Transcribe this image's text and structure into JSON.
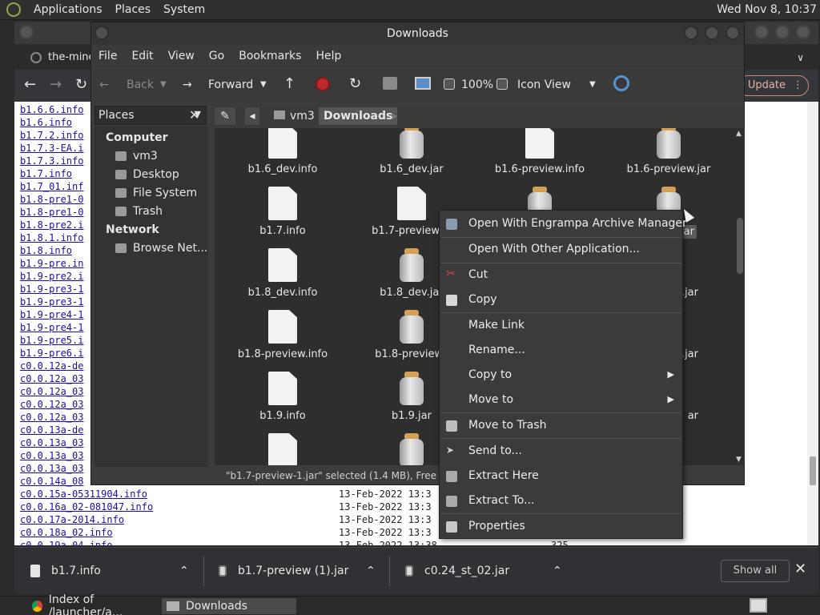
{
  "top_panel": {
    "menus": [
      "Applications",
      "Places",
      "System"
    ],
    "clock": "Wed Nov 8, 10:37"
  },
  "browser": {
    "tab_title": "the-mine",
    "update_label": "Update",
    "listing_rows": [
      "b1.6.6.info",
      "b1.6.info",
      "b1.7.2.info",
      "b1.7.3-EA.i",
      "b1.7.3.info",
      "b1.7.info",
      "b1.7_01.inf",
      "b1.8-pre1-0",
      "b1.8-pre1-0",
      "b1.8-pre2.i",
      "b1.8.1.info",
      "b1.8.info",
      "b1.9-pre.in",
      "b1.9-pre2.i",
      "b1.9-pre3-1",
      "b1.9-pre3-1",
      "b1.9-pre4-1",
      "b1.9-pre4-1",
      "b1.9-pre5.i",
      "b1.9-pre6.i",
      "c0.0.12a-de",
      "c0.0.12a_03",
      "c0.0.12a_03",
      "c0.0.12a_03",
      "c0.0.12a_03",
      "c0.0.13a-de",
      "c0.0.13a_03",
      "c0.0.13a_03",
      "c0.0.13a_03",
      "c0.0.14a_08",
      "c0.0.15a-05311904.info",
      "c0.0.16a_02-081047.info",
      "c0.0.17a-2014.info",
      "c0.0.18a_02.info",
      "c0.0.19a_04.info"
    ],
    "listing_dates": [
      "13-Feb-2022 13:3",
      "13-Feb-2022 13:3",
      "13-Feb-2022 13:3",
      "13-Feb-2022 13:3",
      "13-Feb-2022 13:38"
    ],
    "listing_last_size": "325"
  },
  "downloads_bar": {
    "items": [
      "b1.7.info",
      "b1.7-preview (1).jar",
      "c0.24_st_02.jar"
    ],
    "show_all": "Show all"
  },
  "taskbar": {
    "tasks": [
      "Index of /launcher/a...",
      "Downloads"
    ]
  },
  "file_manager": {
    "title": "Downloads",
    "menus": [
      "File",
      "Edit",
      "View",
      "Go",
      "Bookmarks",
      "Help"
    ],
    "toolbar": {
      "back": "Back",
      "forward": "Forward",
      "zoom": "100%",
      "view_mode": "Icon View"
    },
    "sidebar": {
      "header": "Places",
      "sections": [
        {
          "title": "Computer",
          "items": [
            "vm3",
            "Desktop",
            "File System",
            "Trash"
          ]
        },
        {
          "title": "Network",
          "items": [
            "Browse Net..."
          ]
        }
      ]
    },
    "path": [
      "vm3",
      "Downloads"
    ],
    "files": [
      {
        "name": "b1.6_dev.info",
        "type": "doc"
      },
      {
        "name": "b1.6_dev.jar",
        "type": "jar"
      },
      {
        "name": "b1.6-preview.info",
        "type": "doc"
      },
      {
        "name": "b1.6-preview.jar",
        "type": "jar"
      },
      {
        "name": "b1.7.info",
        "type": "doc"
      },
      {
        "name": "b1.7-preview.in",
        "type": "doc"
      },
      {
        "name": "",
        "type": "jar"
      },
      {
        "name": "w-1.jar",
        "type": "jar"
      },
      {
        "name": "b1.8_dev.info",
        "type": "doc"
      },
      {
        "name": "b1.8_dev.jar",
        "type": "jar"
      },
      {
        "name": "",
        "type": "none"
      },
      {
        "name": "1.jar",
        "type": "none"
      },
      {
        "name": "b1.8-preview.info",
        "type": "doc"
      },
      {
        "name": "b1.8-preview.j",
        "type": "jar"
      },
      {
        "name": "",
        "type": "none"
      },
      {
        "name": "w-1.jar",
        "type": "none"
      },
      {
        "name": "b1.9.info",
        "type": "doc"
      },
      {
        "name": "b1.9.jar",
        "type": "jar"
      },
      {
        "name": "",
        "type": "none"
      },
      {
        "name": "ar",
        "type": "none"
      },
      {
        "name": "",
        "type": "doc"
      },
      {
        "name": "",
        "type": "jar"
      }
    ],
    "status": "\"b1.7-preview-1.jar\" selected (1.4 MB), Free space: 24.8"
  },
  "context_menu": {
    "items": [
      "Open With Engrampa Archive Manager",
      "Open With Other Application...",
      "Cut",
      "Copy",
      "Make Link",
      "Rename...",
      "Copy to",
      "Move to",
      "Move to Trash",
      "Send to...",
      "Extract Here",
      "Extract To...",
      "Properties"
    ]
  }
}
